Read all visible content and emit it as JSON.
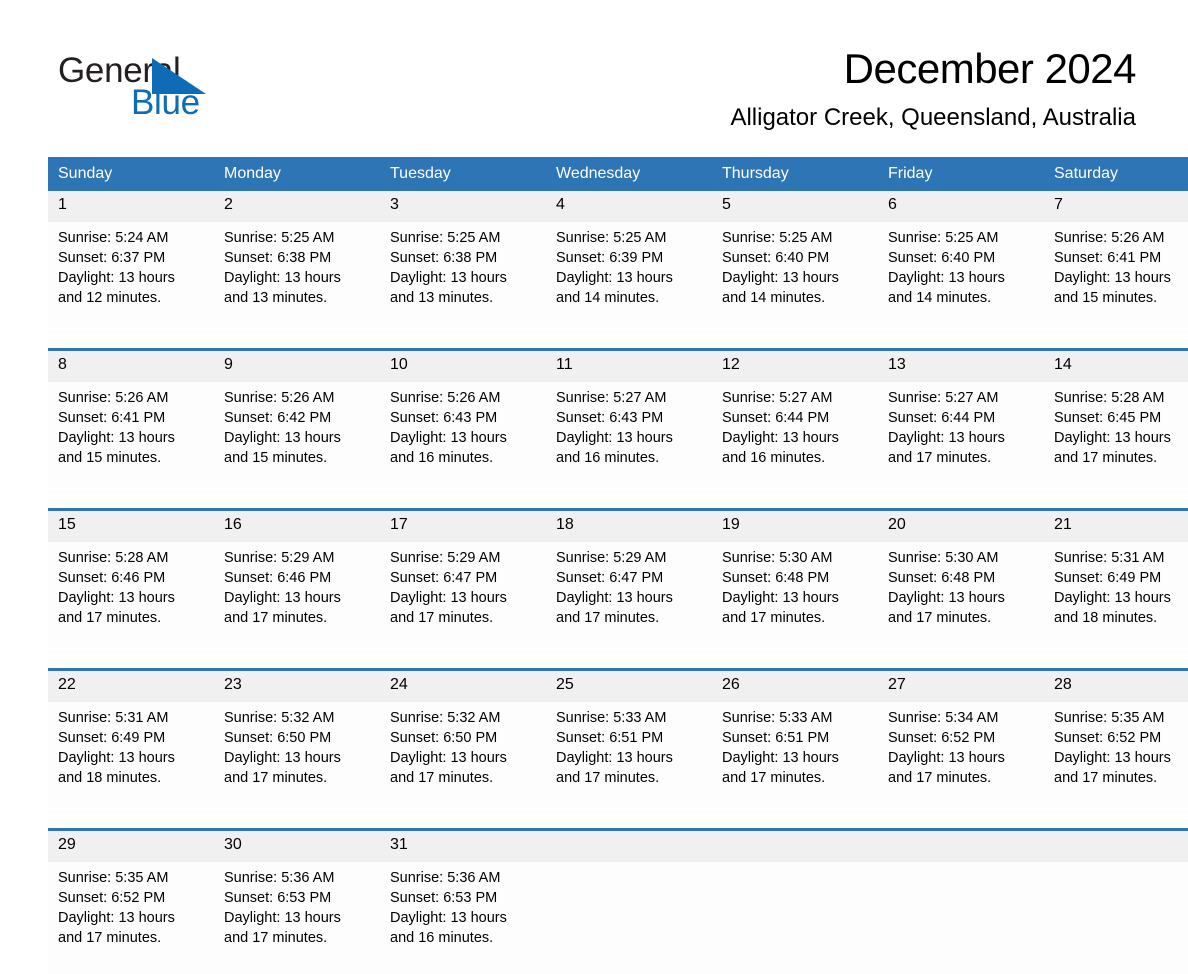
{
  "logo": {
    "word1": "General",
    "word2": "Blue",
    "triangle_color": "#0d6cb5"
  },
  "header": {
    "title": "December 2024",
    "location": "Alligator Creek, Queensland, Australia"
  },
  "theme": {
    "header_blue": "#2e75b6",
    "daynum_band": "#f0f0f0",
    "cell_bg": "#fdfdfd",
    "text": "#000000"
  },
  "calendar": {
    "weekday_headers": [
      "Sunday",
      "Monday",
      "Tuesday",
      "Wednesday",
      "Thursday",
      "Friday",
      "Saturday"
    ],
    "weeks": [
      [
        {
          "day": "1",
          "sunrise": "Sunrise: 5:24 AM",
          "sunset": "Sunset: 6:37 PM",
          "daylight1": "Daylight: 13 hours",
          "daylight2": "and 12 minutes."
        },
        {
          "day": "2",
          "sunrise": "Sunrise: 5:25 AM",
          "sunset": "Sunset: 6:38 PM",
          "daylight1": "Daylight: 13 hours",
          "daylight2": "and 13 minutes."
        },
        {
          "day": "3",
          "sunrise": "Sunrise: 5:25 AM",
          "sunset": "Sunset: 6:38 PM",
          "daylight1": "Daylight: 13 hours",
          "daylight2": "and 13 minutes."
        },
        {
          "day": "4",
          "sunrise": "Sunrise: 5:25 AM",
          "sunset": "Sunset: 6:39 PM",
          "daylight1": "Daylight: 13 hours",
          "daylight2": "and 14 minutes."
        },
        {
          "day": "5",
          "sunrise": "Sunrise: 5:25 AM",
          "sunset": "Sunset: 6:40 PM",
          "daylight1": "Daylight: 13 hours",
          "daylight2": "and 14 minutes."
        },
        {
          "day": "6",
          "sunrise": "Sunrise: 5:25 AM",
          "sunset": "Sunset: 6:40 PM",
          "daylight1": "Daylight: 13 hours",
          "daylight2": "and 14 minutes."
        },
        {
          "day": "7",
          "sunrise": "Sunrise: 5:26 AM",
          "sunset": "Sunset: 6:41 PM",
          "daylight1": "Daylight: 13 hours",
          "daylight2": "and 15 minutes."
        }
      ],
      [
        {
          "day": "8",
          "sunrise": "Sunrise: 5:26 AM",
          "sunset": "Sunset: 6:41 PM",
          "daylight1": "Daylight: 13 hours",
          "daylight2": "and 15 minutes."
        },
        {
          "day": "9",
          "sunrise": "Sunrise: 5:26 AM",
          "sunset": "Sunset: 6:42 PM",
          "daylight1": "Daylight: 13 hours",
          "daylight2": "and 15 minutes."
        },
        {
          "day": "10",
          "sunrise": "Sunrise: 5:26 AM",
          "sunset": "Sunset: 6:43 PM",
          "daylight1": "Daylight: 13 hours",
          "daylight2": "and 16 minutes."
        },
        {
          "day": "11",
          "sunrise": "Sunrise: 5:27 AM",
          "sunset": "Sunset: 6:43 PM",
          "daylight1": "Daylight: 13 hours",
          "daylight2": "and 16 minutes."
        },
        {
          "day": "12",
          "sunrise": "Sunrise: 5:27 AM",
          "sunset": "Sunset: 6:44 PM",
          "daylight1": "Daylight: 13 hours",
          "daylight2": "and 16 minutes."
        },
        {
          "day": "13",
          "sunrise": "Sunrise: 5:27 AM",
          "sunset": "Sunset: 6:44 PM",
          "daylight1": "Daylight: 13 hours",
          "daylight2": "and 17 minutes."
        },
        {
          "day": "14",
          "sunrise": "Sunrise: 5:28 AM",
          "sunset": "Sunset: 6:45 PM",
          "daylight1": "Daylight: 13 hours",
          "daylight2": "and 17 minutes."
        }
      ],
      [
        {
          "day": "15",
          "sunrise": "Sunrise: 5:28 AM",
          "sunset": "Sunset: 6:46 PM",
          "daylight1": "Daylight: 13 hours",
          "daylight2": "and 17 minutes."
        },
        {
          "day": "16",
          "sunrise": "Sunrise: 5:29 AM",
          "sunset": "Sunset: 6:46 PM",
          "daylight1": "Daylight: 13 hours",
          "daylight2": "and 17 minutes."
        },
        {
          "day": "17",
          "sunrise": "Sunrise: 5:29 AM",
          "sunset": "Sunset: 6:47 PM",
          "daylight1": "Daylight: 13 hours",
          "daylight2": "and 17 minutes."
        },
        {
          "day": "18",
          "sunrise": "Sunrise: 5:29 AM",
          "sunset": "Sunset: 6:47 PM",
          "daylight1": "Daylight: 13 hours",
          "daylight2": "and 17 minutes."
        },
        {
          "day": "19",
          "sunrise": "Sunrise: 5:30 AM",
          "sunset": "Sunset: 6:48 PM",
          "daylight1": "Daylight: 13 hours",
          "daylight2": "and 17 minutes."
        },
        {
          "day": "20",
          "sunrise": "Sunrise: 5:30 AM",
          "sunset": "Sunset: 6:48 PM",
          "daylight1": "Daylight: 13 hours",
          "daylight2": "and 17 minutes."
        },
        {
          "day": "21",
          "sunrise": "Sunrise: 5:31 AM",
          "sunset": "Sunset: 6:49 PM",
          "daylight1": "Daylight: 13 hours",
          "daylight2": "and 18 minutes."
        }
      ],
      [
        {
          "day": "22",
          "sunrise": "Sunrise: 5:31 AM",
          "sunset": "Sunset: 6:49 PM",
          "daylight1": "Daylight: 13 hours",
          "daylight2": "and 18 minutes."
        },
        {
          "day": "23",
          "sunrise": "Sunrise: 5:32 AM",
          "sunset": "Sunset: 6:50 PM",
          "daylight1": "Daylight: 13 hours",
          "daylight2": "and 17 minutes."
        },
        {
          "day": "24",
          "sunrise": "Sunrise: 5:32 AM",
          "sunset": "Sunset: 6:50 PM",
          "daylight1": "Daylight: 13 hours",
          "daylight2": "and 17 minutes."
        },
        {
          "day": "25",
          "sunrise": "Sunrise: 5:33 AM",
          "sunset": "Sunset: 6:51 PM",
          "daylight1": "Daylight: 13 hours",
          "daylight2": "and 17 minutes."
        },
        {
          "day": "26",
          "sunrise": "Sunrise: 5:33 AM",
          "sunset": "Sunset: 6:51 PM",
          "daylight1": "Daylight: 13 hours",
          "daylight2": "and 17 minutes."
        },
        {
          "day": "27",
          "sunrise": "Sunrise: 5:34 AM",
          "sunset": "Sunset: 6:52 PM",
          "daylight1": "Daylight: 13 hours",
          "daylight2": "and 17 minutes."
        },
        {
          "day": "28",
          "sunrise": "Sunrise: 5:35 AM",
          "sunset": "Sunset: 6:52 PM",
          "daylight1": "Daylight: 13 hours",
          "daylight2": "and 17 minutes."
        }
      ],
      [
        {
          "day": "29",
          "sunrise": "Sunrise: 5:35 AM",
          "sunset": "Sunset: 6:52 PM",
          "daylight1": "Daylight: 13 hours",
          "daylight2": "and 17 minutes."
        },
        {
          "day": "30",
          "sunrise": "Sunrise: 5:36 AM",
          "sunset": "Sunset: 6:53 PM",
          "daylight1": "Daylight: 13 hours",
          "daylight2": "and 17 minutes."
        },
        {
          "day": "31",
          "sunrise": "Sunrise: 5:36 AM",
          "sunset": "Sunset: 6:53 PM",
          "daylight1": "Daylight: 13 hours",
          "daylight2": "and 16 minutes."
        },
        {
          "day": "",
          "sunrise": "",
          "sunset": "",
          "daylight1": "",
          "daylight2": ""
        },
        {
          "day": "",
          "sunrise": "",
          "sunset": "",
          "daylight1": "",
          "daylight2": ""
        },
        {
          "day": "",
          "sunrise": "",
          "sunset": "",
          "daylight1": "",
          "daylight2": ""
        },
        {
          "day": "",
          "sunrise": "",
          "sunset": "",
          "daylight1": "",
          "daylight2": ""
        }
      ]
    ]
  }
}
